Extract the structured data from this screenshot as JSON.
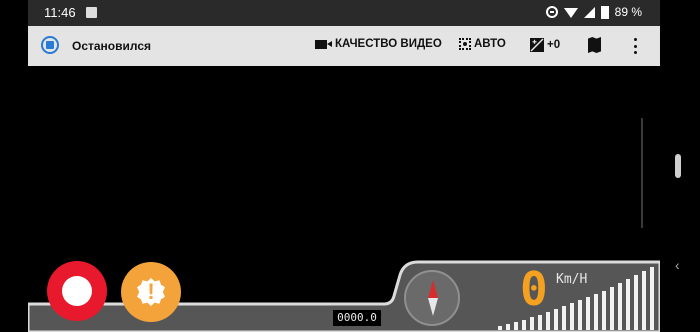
{
  "statusbar": {
    "time": "11:46",
    "battery": "89 %"
  },
  "toolbar": {
    "status": "Остановился",
    "quality_label": "КАЧЕСТВО ВИДЕО",
    "focus_label": "АВТО",
    "exposure_label": "+0"
  },
  "dashboard": {
    "odometer": "0000.0",
    "speed": "0",
    "speed_unit": "Km/H"
  },
  "colors": {
    "record": "#e8192c",
    "alert": "#f4a23a",
    "speed_digits": "#f4a020",
    "toolbar_bg": "#e4e4e4",
    "status_icon": "#2a7bd4"
  },
  "icons": [
    "gallery-icon",
    "dnd-icon",
    "wifi-icon",
    "signal-icon",
    "battery-icon",
    "recording-status-icon",
    "video-camera-icon",
    "focus-icon",
    "exposure-icon",
    "map-icon",
    "more-vert-icon",
    "record-icon",
    "alert-icon",
    "compass-icon"
  ]
}
